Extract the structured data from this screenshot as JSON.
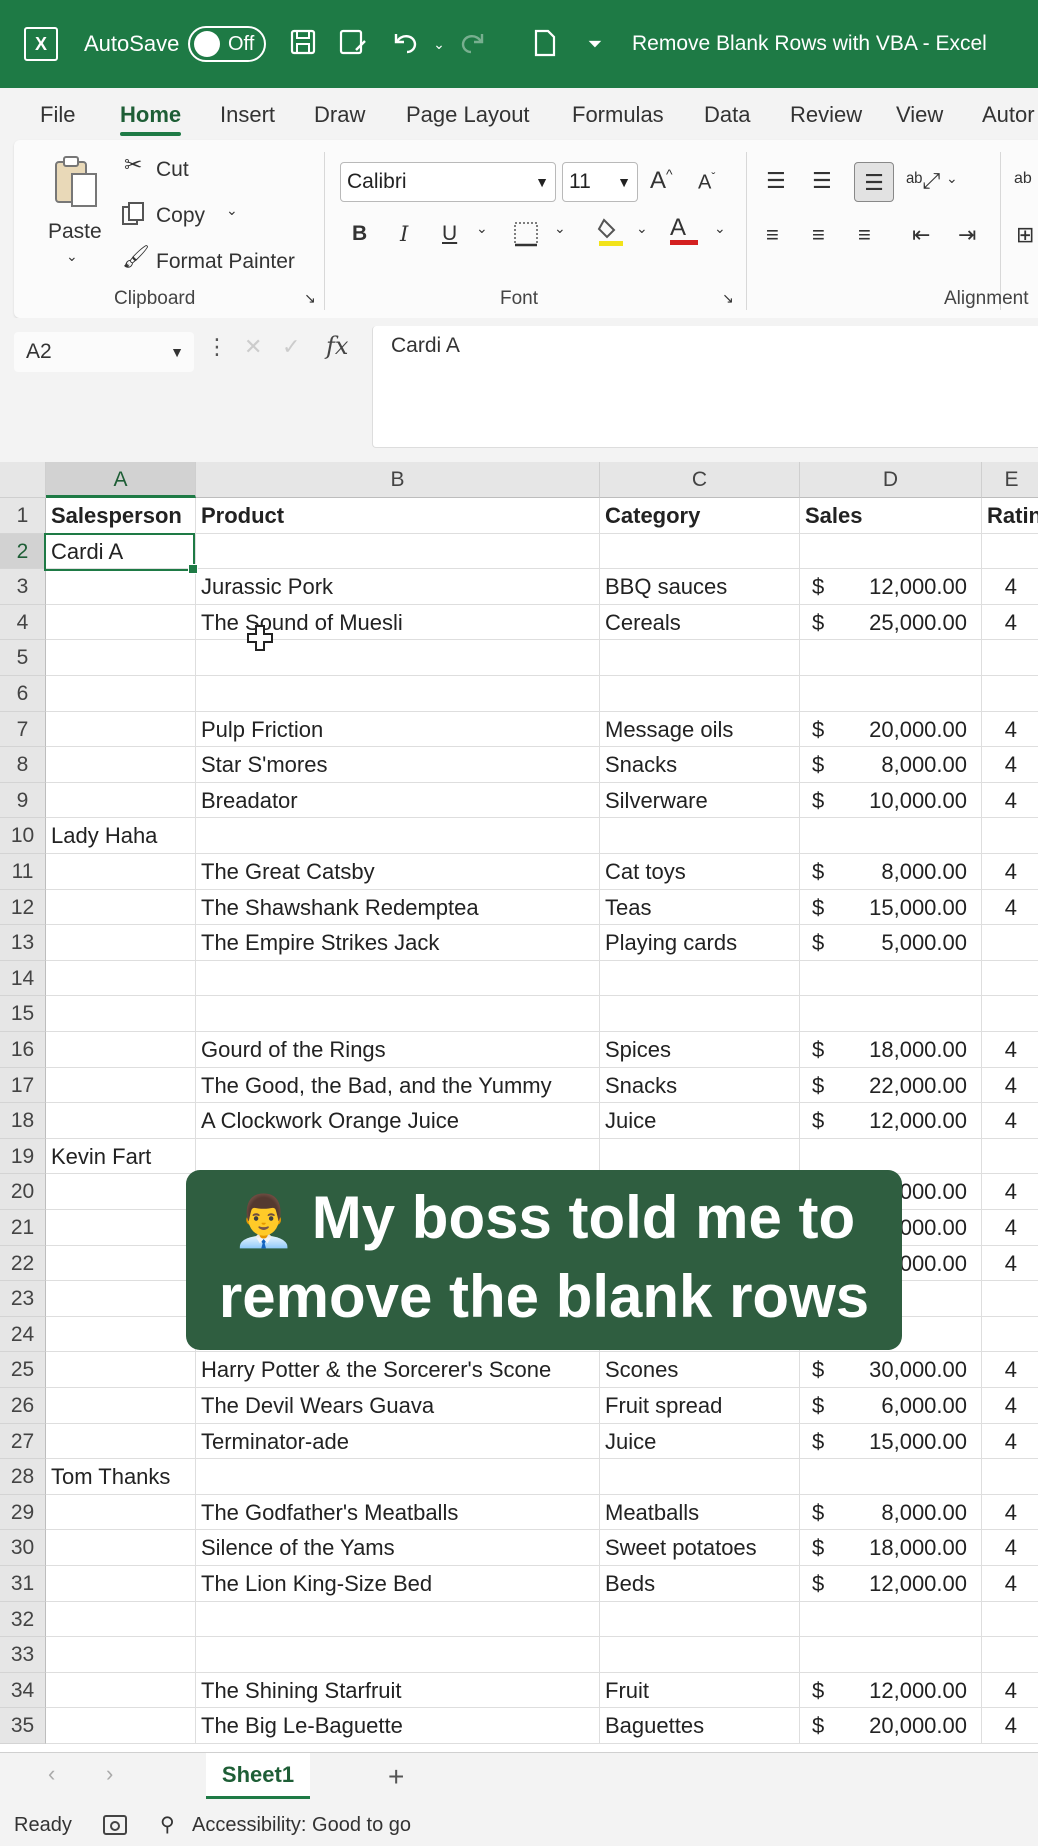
{
  "titlebar": {
    "autosave_label": "AutoSave",
    "autosave_state": "Off",
    "title": "Remove Blank Rows with VBA  -  Excel"
  },
  "tabs": [
    "File",
    "Home",
    "Insert",
    "Draw",
    "Page Layout",
    "Formulas",
    "Data",
    "Review",
    "View",
    "Autor"
  ],
  "active_tab": "Home",
  "ribbon": {
    "paste_label": "Paste",
    "cut_label": "Cut",
    "copy_label": "Copy",
    "format_painter_label": "Format Painter",
    "clipboard_label": "Clipboard",
    "font_name": "Calibri",
    "font_size": "11",
    "font_label": "Font",
    "alignment_label": "Alignment",
    "bold": "B",
    "italic": "I",
    "underline": "U",
    "grow_font": "A",
    "shrink_font": "A",
    "font_color": "A"
  },
  "formula_bar": {
    "name_box": "A2",
    "fx": "fx",
    "value": "Cardi A"
  },
  "columns": [
    "A",
    "B",
    "C",
    "D",
    "E"
  ],
  "selected_column": "A",
  "rows": [
    {
      "n": "1",
      "a": "Salesperson",
      "b": "Product",
      "c": "Category",
      "d": "Sales",
      "cur": "",
      "e": "Ratin"
    },
    {
      "n": "2",
      "a": "Cardi A",
      "b": "",
      "c": "",
      "d": "",
      "cur": "",
      "e": ""
    },
    {
      "n": "3",
      "a": "",
      "b": "Jurassic Pork",
      "c": "BBQ sauces",
      "d": "12,000.00",
      "cur": "$",
      "e": "4"
    },
    {
      "n": "4",
      "a": "",
      "b": "The Sound of Muesli",
      "c": "Cereals",
      "d": "25,000.00",
      "cur": "$",
      "e": "4"
    },
    {
      "n": "5",
      "a": "",
      "b": "",
      "c": "",
      "d": "",
      "cur": "",
      "e": ""
    },
    {
      "n": "6",
      "a": "",
      "b": "",
      "c": "",
      "d": "",
      "cur": "",
      "e": ""
    },
    {
      "n": "7",
      "a": "",
      "b": "Pulp Friction",
      "c": "Message oils",
      "d": "20,000.00",
      "cur": "$",
      "e": "4"
    },
    {
      "n": "8",
      "a": "",
      "b": "Star S'mores",
      "c": "Snacks",
      "d": "8,000.00",
      "cur": "$",
      "e": "4"
    },
    {
      "n": "9",
      "a": "",
      "b": "Breadator",
      "c": "Silverware",
      "d": "10,000.00",
      "cur": "$",
      "e": "4"
    },
    {
      "n": "10",
      "a": "Lady Haha",
      "b": "",
      "c": "",
      "d": "",
      "cur": "",
      "e": ""
    },
    {
      "n": "11",
      "a": "",
      "b": "The Great Catsby",
      "c": "Cat toys",
      "d": "8,000.00",
      "cur": "$",
      "e": "4"
    },
    {
      "n": "12",
      "a": "",
      "b": "The Shawshank Redemptea",
      "c": "Teas",
      "d": "15,000.00",
      "cur": "$",
      "e": "4"
    },
    {
      "n": "13",
      "a": "",
      "b": "The Empire Strikes Jack",
      "c": "Playing cards",
      "d": "5,000.00",
      "cur": "$",
      "e": ""
    },
    {
      "n": "14",
      "a": "",
      "b": "",
      "c": "",
      "d": "",
      "cur": "",
      "e": ""
    },
    {
      "n": "15",
      "a": "",
      "b": "",
      "c": "",
      "d": "",
      "cur": "",
      "e": ""
    },
    {
      "n": "16",
      "a": "",
      "b": "Gourd of the Rings",
      "c": "Spices",
      "d": "18,000.00",
      "cur": "$",
      "e": "4"
    },
    {
      "n": "17",
      "a": "",
      "b": "The Good, the Bad, and the Yummy",
      "c": "Snacks",
      "d": "22,000.00",
      "cur": "$",
      "e": "4"
    },
    {
      "n": "18",
      "a": "",
      "b": "A Clockwork Orange Juice",
      "c": "Juice",
      "d": "12,000.00",
      "cur": "$",
      "e": "4"
    },
    {
      "n": "19",
      "a": "Kevin Fart",
      "b": "",
      "c": "",
      "d": "",
      "cur": "",
      "e": ""
    },
    {
      "n": "20",
      "a": "",
      "b": "",
      "c": "",
      "d": "000.00",
      "cur": "",
      "e": "4"
    },
    {
      "n": "21",
      "a": "",
      "b": "",
      "c": "",
      "d": "000.00",
      "cur": "",
      "e": "4"
    },
    {
      "n": "22",
      "a": "",
      "b": "",
      "c": "",
      "d": "000.00",
      "cur": "",
      "e": "4"
    },
    {
      "n": "23",
      "a": "",
      "b": "",
      "c": "",
      "d": "",
      "cur": "",
      "e": ""
    },
    {
      "n": "24",
      "a": "",
      "b": "",
      "c": "",
      "d": "",
      "cur": "",
      "e": ""
    },
    {
      "n": "25",
      "a": "",
      "b": "Harry Potter & the Sorcerer's Scone",
      "c": "Scones",
      "d": "30,000.00",
      "cur": "$",
      "e": "4"
    },
    {
      "n": "26",
      "a": "",
      "b": "The Devil Wears Guava",
      "c": "Fruit spread",
      "d": "6,000.00",
      "cur": "$",
      "e": "4"
    },
    {
      "n": "27",
      "a": "",
      "b": "Terminator-ade",
      "c": "Juice",
      "d": "15,000.00",
      "cur": "$",
      "e": "4"
    },
    {
      "n": "28",
      "a": "Tom Thanks",
      "b": "",
      "c": "",
      "d": "",
      "cur": "",
      "e": ""
    },
    {
      "n": "29",
      "a": "",
      "b": "The Godfather's Meatballs",
      "c": "Meatballs",
      "d": "8,000.00",
      "cur": "$",
      "e": "4"
    },
    {
      "n": "30",
      "a": "",
      "b": "Silence of the Yams",
      "c": "Sweet potatoes",
      "d": "18,000.00",
      "cur": "$",
      "e": "4"
    },
    {
      "n": "31",
      "a": "",
      "b": "The Lion King-Size Bed",
      "c": "Beds",
      "d": "12,000.00",
      "cur": "$",
      "e": "4"
    },
    {
      "n": "32",
      "a": "",
      "b": "",
      "c": "",
      "d": "",
      "cur": "",
      "e": ""
    },
    {
      "n": "33",
      "a": "",
      "b": "",
      "c": "",
      "d": "",
      "cur": "",
      "e": ""
    },
    {
      "n": "34",
      "a": "",
      "b": "The Shining Starfruit",
      "c": "Fruit",
      "d": "12,000.00",
      "cur": "$",
      "e": "4"
    },
    {
      "n": "35",
      "a": "",
      "b": "The Big Le-Baguette",
      "c": "Baguettes",
      "d": "20,000.00",
      "cur": "$",
      "e": "4"
    }
  ],
  "sheet_tab": "Sheet1",
  "status": {
    "ready": "Ready",
    "accessibility": "Accessibility: Good to go"
  },
  "caption": {
    "emoji": "👨‍💼",
    "line1": "My boss told me to",
    "line2": "remove the blank rows"
  },
  "colors": {
    "excel_green": "#1e7a45",
    "caption_bg": "#2f5e40"
  }
}
